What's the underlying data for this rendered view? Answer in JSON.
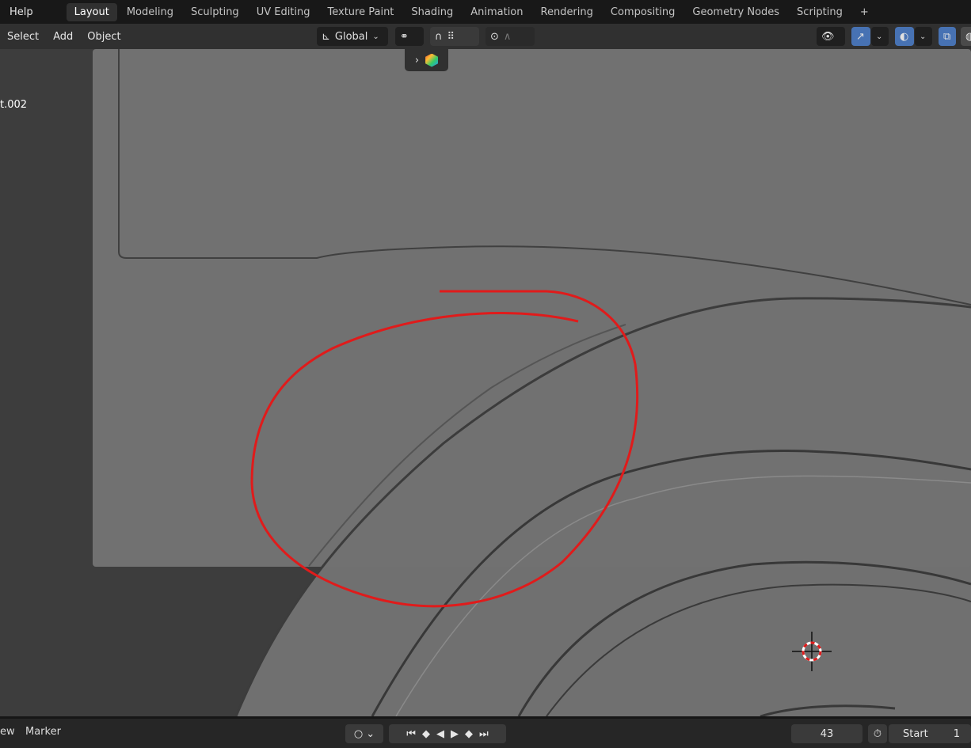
{
  "topbar": {
    "help": "Help",
    "tabs": [
      "Layout",
      "Modeling",
      "Sculpting",
      "UV Editing",
      "Texture Paint",
      "Shading",
      "Animation",
      "Rendering",
      "Compositing",
      "Geometry Nodes",
      "Scripting"
    ],
    "active_tab": "Layout",
    "add_tab": "+"
  },
  "header": {
    "menus": [
      "Select",
      "Add",
      "Object"
    ],
    "orientation": "Global"
  },
  "viewport": {
    "object_label": "t.002",
    "colors": {
      "surface": "#707070",
      "background": "#3d3d3d",
      "annotation": "#e01b1b"
    }
  },
  "timeline": {
    "menus": [
      "ew",
      "Marker"
    ],
    "current_frame": "43",
    "start_label": "Start",
    "start_value": "1"
  }
}
